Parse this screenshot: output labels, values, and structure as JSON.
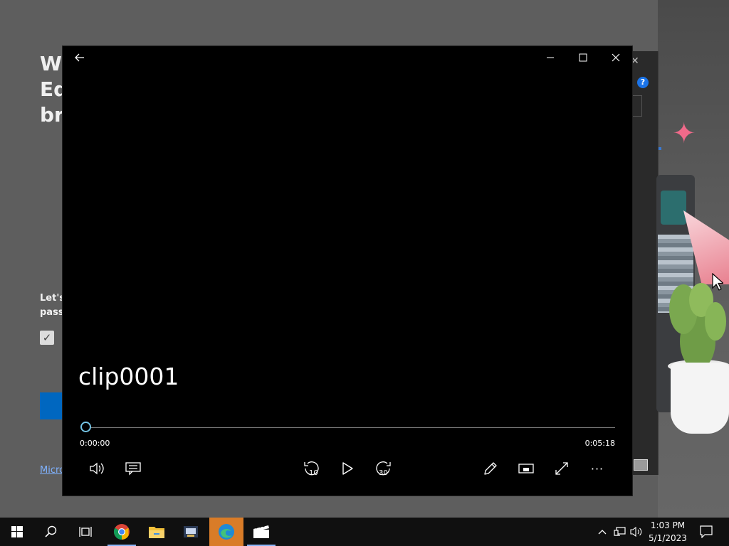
{
  "background_window": {
    "title_lines": "We\nEd\nbr",
    "text_lines": "Let's\npassw",
    "checkbox_mark": "✓",
    "link_text": "Micro"
  },
  "dialog": {
    "close_glyph": "✕",
    "help_glyph": "?"
  },
  "player": {
    "video_title": "clip0001",
    "current_time": "0:00:00",
    "total_time": "0:05:18",
    "progress": 0,
    "skip_back_seconds": "10",
    "skip_forward_seconds": "30",
    "accent_color": "#74c3e3",
    "title_bar": {
      "back_icon": "back-arrow-icon",
      "minimize_glyph": "─",
      "maximize_glyph": "☐",
      "close_glyph": "✕"
    },
    "more_glyph": "···"
  },
  "taskbar": {
    "time": "1:03 PM",
    "date": "5/1/2023",
    "items": [
      "start-icon",
      "search-icon",
      "task-view-icon",
      "chrome-icon",
      "file-explorer-icon",
      "app-icon",
      "edge-icon",
      "movies-tv-icon"
    ],
    "active_item_color": "#d97c28"
  }
}
